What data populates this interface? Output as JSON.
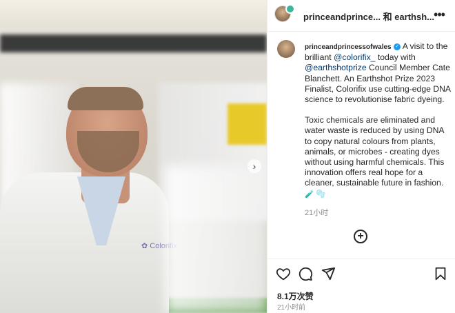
{
  "header": {
    "title": "princeandprince... 和 earthsh...",
    "more_icon": "more-horizontal-icon"
  },
  "caption": {
    "username": "princeandprincessofwales",
    "p1_a": " A visit to the brilliant ",
    "mention1": "@colorifix_",
    "p1_b": " today with ",
    "mention2": "@earthshotprize",
    "p1_c": " Council Member Cate Blanchett. An Earthshot Prize 2023 Finalist, Colorifix use cutting-edge DNA science to revolutionise fabric dyeing.",
    "p2": "Toxic chemicals are eliminated and water waste is reduced by using DNA to copy natural colours from plants, animals, or microbes - creating dyes without using harmful chemicals. This innovation offers real hope for a cleaner, sustainable future in fashion. ",
    "emoji": "🧪 🫧",
    "time": "21小时"
  },
  "photo": {
    "logo_text": "Colorifix"
  },
  "footer": {
    "likes": "8.1万次赞",
    "time": "21小时前"
  },
  "icons": {
    "like": "heart-icon",
    "comment": "comment-icon",
    "share": "send-icon",
    "save": "bookmark-icon",
    "next": "chevron-right-icon",
    "add": "add-comment-icon"
  },
  "colors": {
    "link": "#00376b",
    "verified": "#1d9bf0",
    "muted": "#8e8e8e"
  }
}
